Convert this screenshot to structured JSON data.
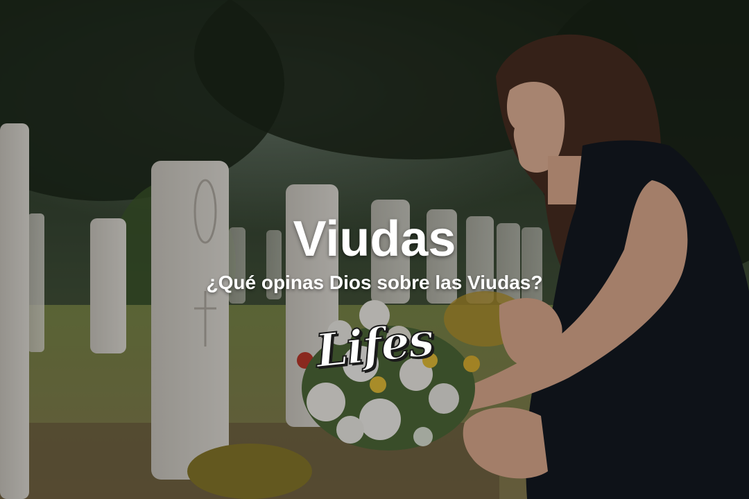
{
  "headline": {
    "title": "Viudas",
    "subtitle": "¿Qué opinas Dios sobre las Viudas?"
  },
  "logo": {
    "text": "Lifes"
  },
  "colors": {
    "text": "#ffffff",
    "dress": "#141a22",
    "headstone": "#d9d6cf",
    "foliage": "#2c3a26"
  }
}
